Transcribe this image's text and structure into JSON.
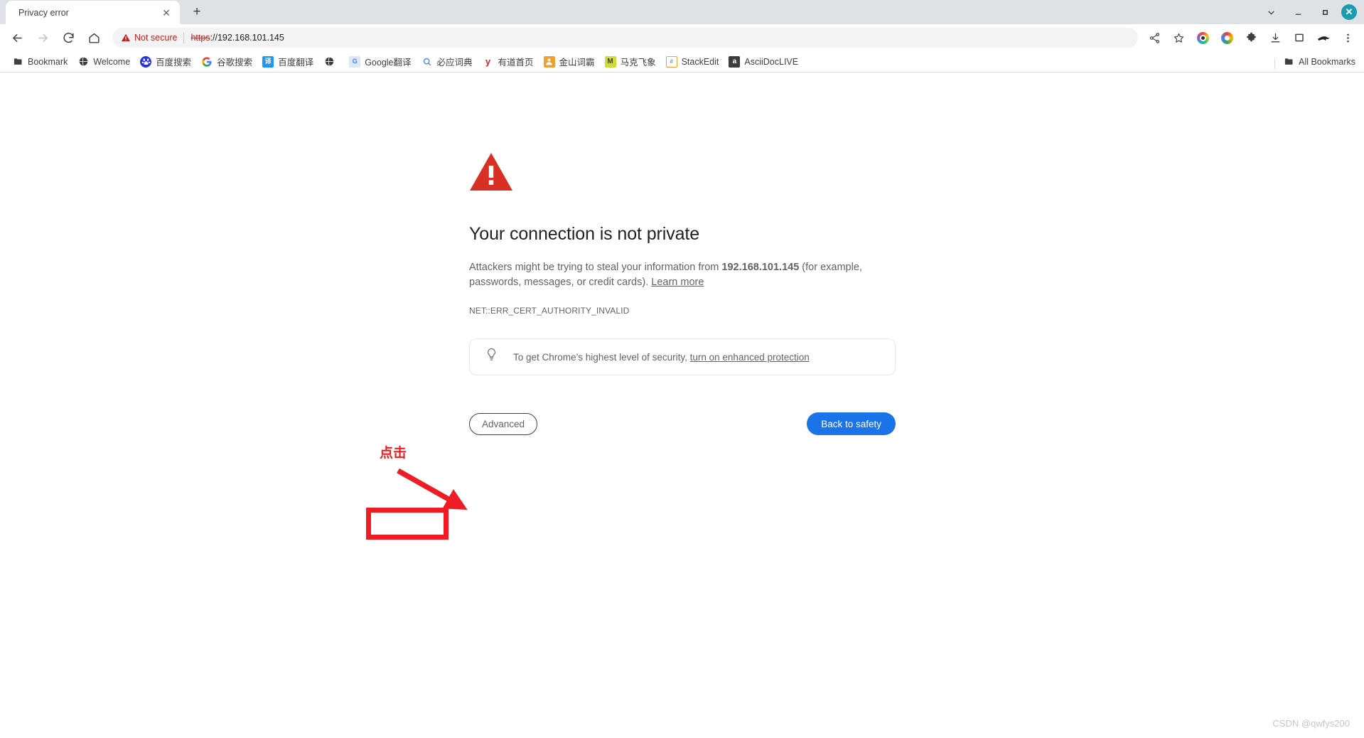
{
  "window": {
    "controls": {
      "chevron": "chevron-down",
      "minimize": "—",
      "maximize": "□",
      "close": "✕"
    }
  },
  "tabstrip": {
    "tabs": [
      {
        "title": "Privacy error",
        "close_label": "✕"
      }
    ],
    "new_tab_label": "+"
  },
  "toolbar": {
    "back_label": "←",
    "forward_label": "→",
    "reload_label": "↻",
    "home_label": "⌂",
    "security_text": "Not secure",
    "url_scheme": "https",
    "url_rest": "://192.168.101.145",
    "icons": {
      "share": "share-icon",
      "bookmark_star": "star-icon",
      "extension_rainbow": "extension-rainbow-icon",
      "extension_ring": "extension-ring-icon",
      "extensions_puzzle": "puzzle-icon",
      "downloads": "download-icon",
      "side_panel": "side-panel-icon",
      "profile": "profile-icon",
      "menu": "three-dot-menu-icon"
    }
  },
  "bookmarks_bar": {
    "items": [
      {
        "label": "Bookmark",
        "icon": "folder-icon",
        "glyph": "▮",
        "cls": "ico-folder"
      },
      {
        "label": "Welcome",
        "icon": "globe-icon",
        "glyph": "⊕",
        "cls": "ico-globe"
      },
      {
        "label": "百度搜索",
        "icon": "baidu-icon",
        "glyph": "熊",
        "cls": "ico-baidu"
      },
      {
        "label": "谷歌搜索",
        "icon": "google-icon",
        "glyph": "G",
        "cls": "ico-google"
      },
      {
        "label": "百度翻译",
        "icon": "baidu-translate-icon",
        "glyph": "译",
        "cls": "ico-fanyi"
      },
      {
        "label": "",
        "icon": "globe-icon",
        "glyph": "⊕",
        "cls": "ico-globe"
      },
      {
        "label": "Google翻译",
        "icon": "google-translate-icon",
        "glyph": "G",
        "cls": "ico-gt"
      },
      {
        "label": "必应词典",
        "icon": "search-icon",
        "glyph": "⌕",
        "cls": "ico-search"
      },
      {
        "label": "有道首页",
        "icon": "youdao-icon",
        "glyph": "y",
        "cls": "ico-youdao"
      },
      {
        "label": "金山词霸",
        "icon": "jinshan-icon",
        "glyph": "金",
        "cls": "ico-jinshan"
      },
      {
        "label": "马克飞象",
        "icon": "maxiang-icon",
        "glyph": "M",
        "cls": "ico-maxiang"
      },
      {
        "label": "StackEdit",
        "icon": "stackedit-icon",
        "glyph": "#",
        "cls": "ico-stackedit"
      },
      {
        "label": "AsciiDocLIVE",
        "icon": "asciidoc-icon",
        "glyph": "a",
        "cls": "ico-asciidoc"
      }
    ],
    "all_bookmarks_label": "All Bookmarks"
  },
  "interstitial": {
    "headline": "Your connection is not private",
    "body_prefix": "Attackers might be trying to steal your information from ",
    "body_host": "192.168.101.145",
    "body_suffix": " (for example, passwords, messages, or credit cards). ",
    "learn_more_label": "Learn more",
    "error_code": "NET::ERR_CERT_AUTHORITY_INVALID",
    "promo_text": "To get Chrome’s highest level of security, ",
    "promo_link": "turn on enhanced protection",
    "advanced_label": "Advanced",
    "back_to_safety_label": "Back to safety",
    "colors": {
      "warning_red": "#d93025",
      "primary_blue": "#1a73e8",
      "text_gray": "#5f6368"
    }
  },
  "annotation": {
    "label": "点击",
    "color": "#ee1c25"
  },
  "watermark": {
    "text": "CSDN @qwfys200"
  }
}
